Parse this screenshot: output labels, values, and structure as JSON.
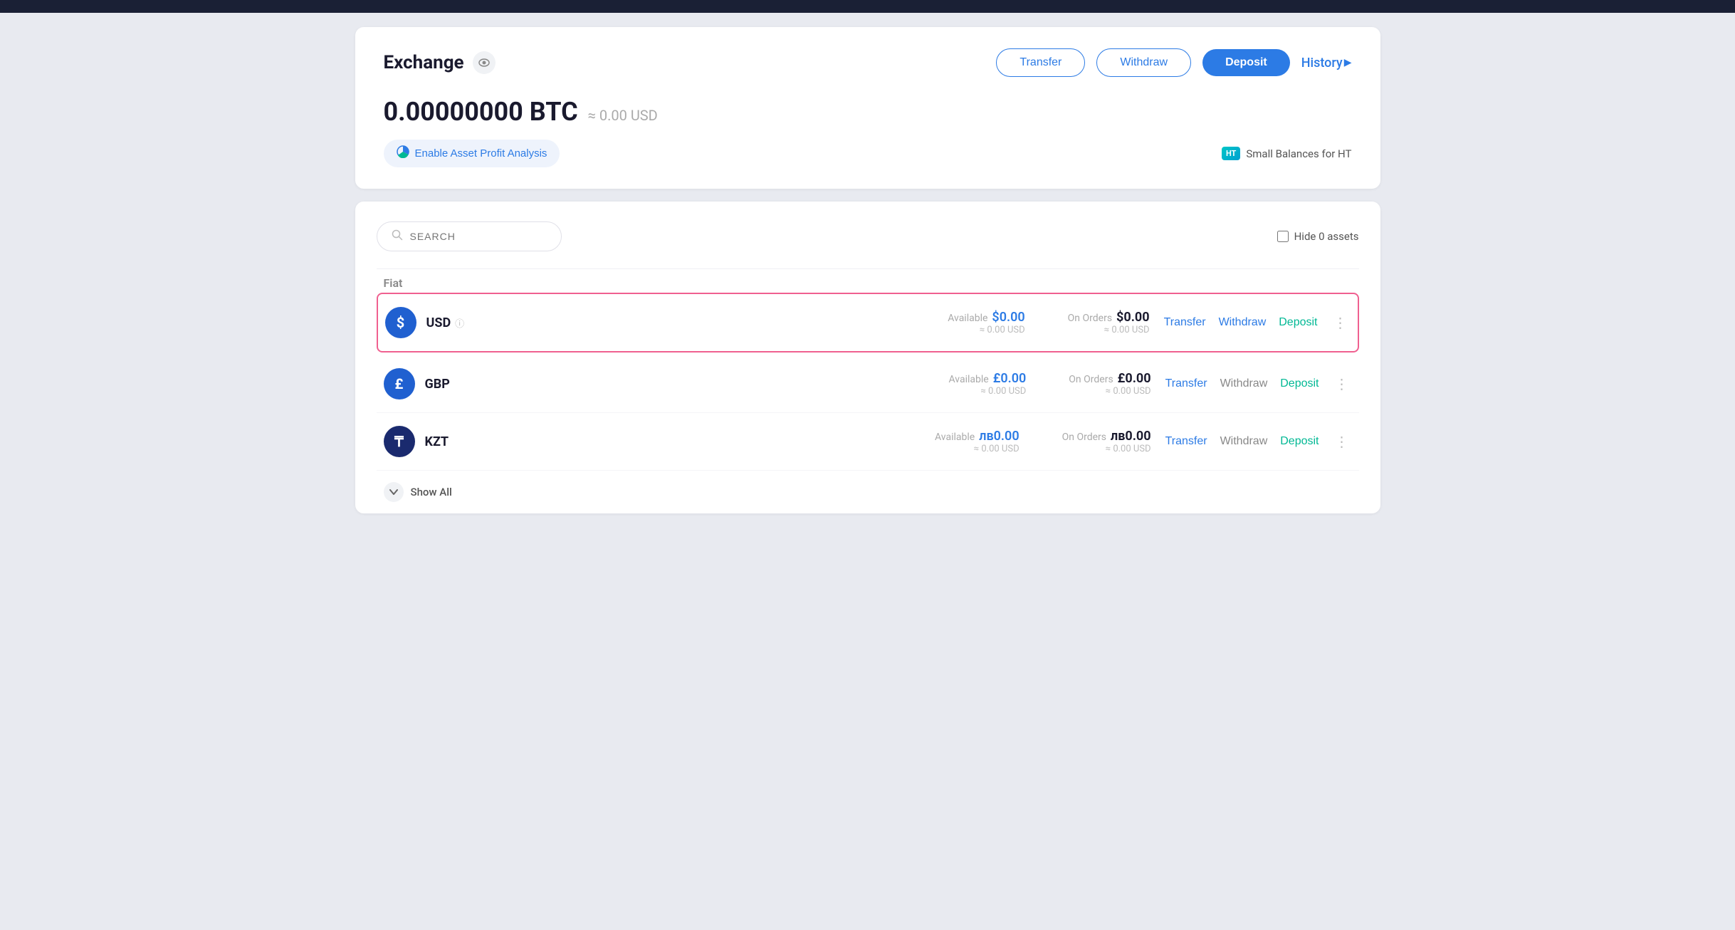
{
  "topBar": {},
  "header": {
    "title": "Exchange",
    "buttons": {
      "transfer": "Transfer",
      "withdraw": "Withdraw",
      "deposit": "Deposit",
      "history": "History",
      "historyArrow": "▶"
    }
  },
  "balance": {
    "btc": "0.00000000 BTC",
    "usd": "≈ 0.00 USD"
  },
  "enableAnalysis": {
    "label": "Enable Asset Profit Analysis",
    "icon": "📊"
  },
  "smallBalances": {
    "label": "Small Balances for HT",
    "badge": "HT"
  },
  "search": {
    "placeholder": "SEARCH"
  },
  "hideZero": {
    "label": "Hide 0 assets"
  },
  "fiatSection": {
    "label": "Fiat",
    "assets": [
      {
        "symbol": "USD",
        "iconLabel": "$",
        "iconClass": "usd",
        "available": "$0.00",
        "availableUSD": "≈ 0.00 USD",
        "onOrders": "$0.00",
        "onOrdersUSD": "≈ 0.00 USD",
        "highlighted": true,
        "actions": {
          "transfer": "Transfer",
          "withdraw": "Withdraw",
          "deposit": "Deposit"
        },
        "withdrawActive": true
      },
      {
        "symbol": "GBP",
        "iconLabel": "£",
        "iconClass": "gbp",
        "available": "£0.00",
        "availableUSD": "≈ 0.00 USD",
        "onOrders": "£0.00",
        "onOrdersUSD": "≈ 0.00 USD",
        "highlighted": false,
        "actions": {
          "transfer": "Transfer",
          "withdraw": "Withdraw",
          "deposit": "Deposit"
        },
        "withdrawActive": false
      },
      {
        "symbol": "KZT",
        "iconLabel": "₸",
        "iconClass": "kzt",
        "available": "лв0.00",
        "availableUSD": "≈ 0.00 USD",
        "onOrders": "лв0.00",
        "onOrdersUSD": "≈ 0.00 USD",
        "highlighted": false,
        "actions": {
          "transfer": "Transfer",
          "withdraw": "Withdraw",
          "deposit": "Deposit"
        },
        "withdrawActive": false
      }
    ]
  },
  "showAll": {
    "label": "Show All"
  },
  "colors": {
    "blue": "#2c7be5",
    "green": "#00b894",
    "pink": "#f06090",
    "dark": "#1a1a2e"
  }
}
